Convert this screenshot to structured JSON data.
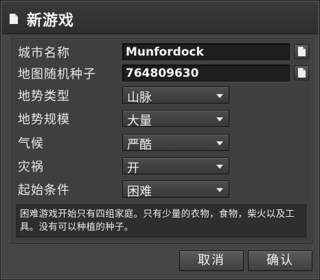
{
  "dialog": {
    "title": "新游戏",
    "title_icon": "document-icon"
  },
  "fields": {
    "city_name": {
      "label": "城市名称",
      "value": "Munfordock"
    },
    "map_seed": {
      "label": "地图随机种子",
      "value": "764809630"
    }
  },
  "dropdowns": [
    {
      "key": "terrain_type",
      "label": "地势类型",
      "value": "山脉"
    },
    {
      "key": "terrain_size",
      "label": "地势规模",
      "value": "大量"
    },
    {
      "key": "climate",
      "label": "气候",
      "value": "严酷"
    },
    {
      "key": "disasters",
      "label": "灾祸",
      "value": "开"
    },
    {
      "key": "start_conditions",
      "label": "起始条件",
      "value": "困难"
    }
  ],
  "description": "困难游戏开始只有四组家庭。只有少量的衣物，食物，柴火以及工具。没有可以种植的种子。",
  "buttons": {
    "cancel": "取消",
    "confirm": "确认"
  }
}
